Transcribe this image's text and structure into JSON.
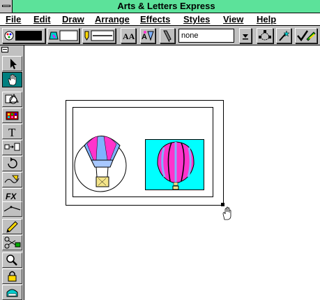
{
  "window": {
    "title": "Arts & Letters Express"
  },
  "menu": [
    "File",
    "Edit",
    "Draw",
    "Arrange",
    "Effects",
    "Styles",
    "View",
    "Help"
  ],
  "toolbar": {
    "style_value": "none",
    "icons": [
      "color-swatch-icon",
      "fill-icon",
      "line-style-icon",
      "type-icon",
      "text-style-icon",
      "pen-icon",
      "dropdown-arrow-icon",
      "node-icon",
      "magic-wand-icon",
      "checkmark-brush-icon"
    ]
  },
  "tools": [
    "pointer-tool",
    "hand-tool",
    "shapes-tool",
    "clipart-tool",
    "text-tool",
    "transform-tool",
    "rotate-tool",
    "freehand-tool",
    "effects-tool",
    "line-tool",
    "pencil-tool",
    "scissors-tool",
    "zoom-tool",
    "lock-tool",
    "fill-tool"
  ],
  "tool_labels": {
    "text": "T",
    "effects": "FX"
  },
  "colors": {
    "titlebar": "#5ce29a",
    "active_tool": "#008080",
    "cyan": "#00ffff",
    "magenta": "#ff33cc",
    "balloon_blue": "#7fb2ff",
    "basket": "#f5e58a"
  }
}
